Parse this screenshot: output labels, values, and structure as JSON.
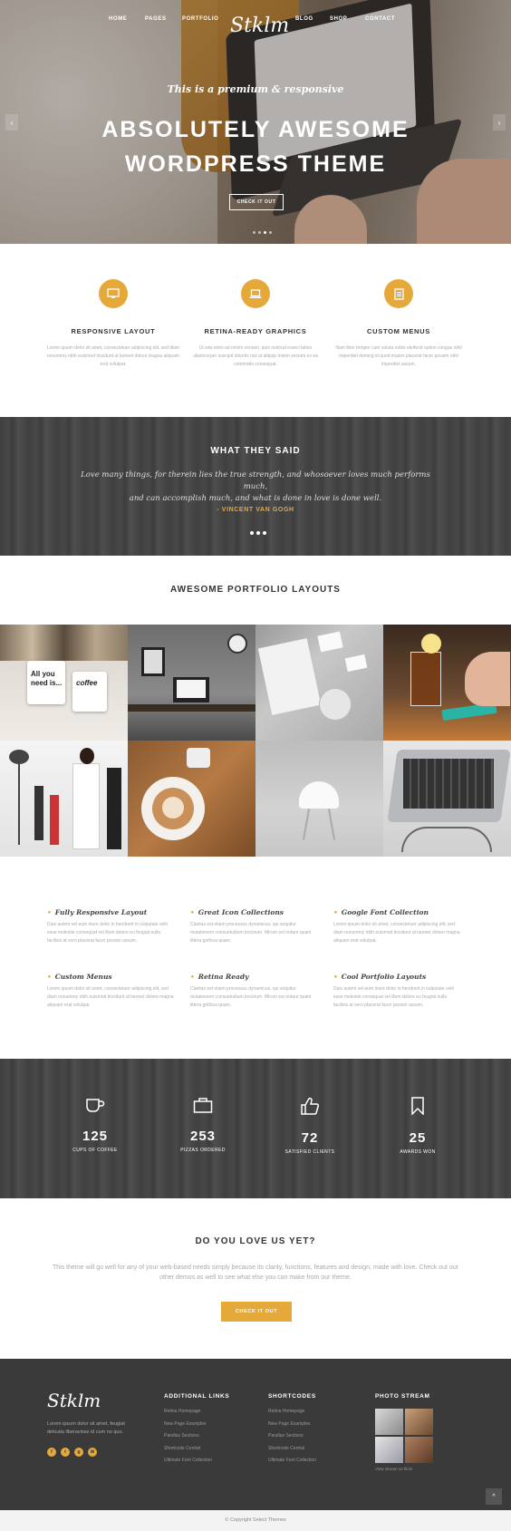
{
  "nav": {
    "left": [
      "HOME",
      "PAGES",
      "PORTFOLIO"
    ],
    "logo": "Stklm",
    "right": [
      "BLOG",
      "SHOP",
      "CONTACT"
    ]
  },
  "hero": {
    "subtitle": "This is a premium & responsive",
    "title_line1": "ABSOLUTELY AWESOME",
    "title_line2": "WORDPRESS THEME",
    "button": "CHECK IT OUT",
    "prev_arrow": "‹",
    "next_arrow": "›"
  },
  "features": [
    {
      "icon": "monitor-icon",
      "title": "RESPONSIVE LAYOUT",
      "text": "Lorem ipsum dolor sit amet, consectetuer adipiscing elit, sed diam nonummy nibh euismod tincidunt ut laoreet dolore magna aliquam erat volutpat."
    },
    {
      "icon": "laptop-icon",
      "title": "RETINA-READY GRAPHICS",
      "text": "Ut wisi enim ad minim veniam, quis nostrud exerci tation ullamcorper suscipit lobortis nisl ut aliquip minim veniam ex ea commodo consequat."
    },
    {
      "icon": "document-icon",
      "title": "CUSTOM MENUS",
      "text": "Nam liber tempor cum soluta nobis eleifend option congue nihil imperdiet doming id quod mazim placerat facer possim nihil imperdiet assum."
    }
  ],
  "testimonial": {
    "title": "WHAT THEY SAID",
    "quote_line1": "Love many things, for therein lies the true strength, and whosoever loves much performs much,",
    "quote_line2": "and can accomplish much, and what is done in love is done well.",
    "author": "- VINCENT VAN GOGH"
  },
  "portfolio": {
    "title": "AWESOME PORTFOLIO LAYOUTS",
    "mug_text_1": "All you need is...",
    "mug_text_2": "coffee"
  },
  "feature_list": [
    {
      "title": "Fully Responsive Layout",
      "text": "Duis autem vel eum iriure dolor in hendrerit in vulputate velit esse molestie consequat vel illum dolore eu feugiat nulla facilisis at vero placerat facer possim assum."
    },
    {
      "title": "Great Icon Collections",
      "text": "Claritas est etiam processus dynamicus, qui sequitur mutationem consuetudium lectorum. Mirum est notare quam littera gothica quam."
    },
    {
      "title": "Google Font Collection",
      "text": "Lorem ipsum dolor sit amet, consectetuer adipiscing elit, sed diam nonummy nibh euismod tincidunt ut laoreet dolore magna aliquam erat volutpat."
    },
    {
      "title": "Custom Menus",
      "text": "Lorem ipsum dolor sit amet, consectetuer adipiscing elit, sed diam nonummy nibh euismod tincidunt ut laoreet dolore magna aliquam erat volutpat."
    },
    {
      "title": "Retina Ready",
      "text": "Claritas est etiam processus dynamicus, qui sequitur mutationem consuetudium lectorum. Mirum est notare quam littera gothica quam."
    },
    {
      "title": "Cool Portfolio Layouts",
      "text": "Duis autem vel eum iriure dolor in hendrerit in vulputate velit esse molestie consequat vel illum dolore eu feugiat nulla facilisis at vero placerat facer possim assum."
    }
  ],
  "counters": [
    {
      "icon": "coffee-cup-icon",
      "number": "125",
      "label": "CUPS OF COFFEE"
    },
    {
      "icon": "briefcase-icon",
      "number": "253",
      "label": "PIZZAS ORDERED"
    },
    {
      "icon": "thumbs-up-icon",
      "number": "72",
      "label": "SATISFIED CLIENTS"
    },
    {
      "icon": "bookmark-icon",
      "number": "25",
      "label": "AWARDS WON"
    }
  ],
  "cta": {
    "title": "DO YOU LOVE US YET?",
    "text": "This theme will go well for any of your web-based needs simply because its clarity, functions, features and design, made with love. Check out our other demos as well to see what else you can make from our theme.",
    "button": "CHECK IT OUT"
  },
  "footer": {
    "logo": "Stklm",
    "text": "Lorem ipsum dolor sit amet, feugiat delicata liberavisse id cum no quo.",
    "socials": [
      "f",
      "t",
      "g",
      "✉"
    ],
    "links_title": "ADDITIONAL LINKS",
    "links": [
      "Retina Homepage",
      "New Page Examples",
      "Parallax Sections",
      "Shortcode Central",
      "Ultimate Font Collection"
    ],
    "shortcodes_title": "SHORTCODES",
    "shortcodes": [
      "Retina Homepage",
      "New Page Examples",
      "Parallax Sections",
      "Shortcode Central",
      "Ultimate Font Collection"
    ],
    "photos_title": "PHOTO STREAM",
    "photos_link": "View stream on flickr",
    "to_top": "^",
    "copyright": "© Copyright Select Themes"
  },
  "colors": {
    "accent": "#e5a93a",
    "dark": "#3a3a3a"
  }
}
